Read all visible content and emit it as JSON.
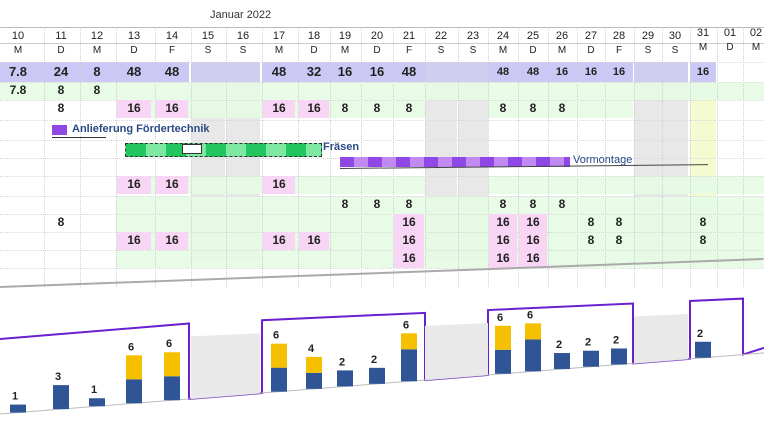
{
  "header": {
    "month": "Januar 2022"
  },
  "days": [
    {
      "d": "10",
      "w": "M"
    },
    {
      "d": "11",
      "w": "D"
    },
    {
      "d": "12",
      "w": "M"
    },
    {
      "d": "13",
      "w": "D"
    },
    {
      "d": "14",
      "w": "F"
    },
    {
      "d": "15",
      "w": "S"
    },
    {
      "d": "16",
      "w": "S"
    },
    {
      "d": "17",
      "w": "M"
    },
    {
      "d": "18",
      "w": "D"
    },
    {
      "d": "19",
      "w": "M"
    },
    {
      "d": "20",
      "w": "D"
    },
    {
      "d": "21",
      "w": "F"
    },
    {
      "d": "22",
      "w": "S"
    },
    {
      "d": "23",
      "w": "S"
    },
    {
      "d": "24",
      "w": "M"
    },
    {
      "d": "25",
      "w": "D"
    },
    {
      "d": "26",
      "w": "M"
    },
    {
      "d": "27",
      "w": "D"
    },
    {
      "d": "28",
      "w": "F"
    },
    {
      "d": "29",
      "w": "S"
    },
    {
      "d": "30",
      "w": "S"
    },
    {
      "d": "31",
      "w": "M"
    },
    {
      "d": "01",
      "w": "D"
    },
    {
      "d": "02",
      "w": "M"
    }
  ],
  "rows": [
    {
      "cells": {
        "0": "7.8",
        "1": "24",
        "2": "8",
        "3": "48",
        "4": "48",
        "7": "48",
        "8": "32",
        "9": "16",
        "10": "16",
        "11": "48",
        "14": "48",
        "15": "48",
        "16": "16",
        "17": "16",
        "18": "16",
        "21": "16"
      }
    },
    {
      "cells": {
        "0": "7.8",
        "1": "8",
        "2": "8"
      }
    },
    {
      "cells": {
        "1": "8",
        "3": "16",
        "4": "16",
        "7": "16",
        "8": "16",
        "9": "8",
        "10": "8",
        "11": "8",
        "14": "8",
        "15": "8",
        "16": "8"
      }
    },
    {
      "cells": {}
    },
    {
      "cells": {}
    },
    {
      "cells": {}
    },
    {
      "cells": {
        "3": "16",
        "4": "16",
        "7": "16"
      }
    },
    {
      "cells": {
        "9": "8",
        "10": "8",
        "11": "8",
        "14": "8",
        "15": "8",
        "16": "8"
      }
    },
    {
      "cells": {
        "1": "8",
        "11": "16",
        "14": "16",
        "15": "16",
        "17": "8",
        "18": "8",
        "21": "8"
      }
    },
    {
      "cells": {
        "3": "16",
        "4": "16",
        "7": "16",
        "8": "16",
        "11": "16",
        "14": "16",
        "15": "16",
        "17": "8",
        "18": "8",
        "21": "8"
      }
    },
    {
      "cells": {
        "11": "16",
        "14": "16",
        "15": "16"
      }
    }
  ],
  "tasks": {
    "anlieferung": "Anlieferung Fördertechnik",
    "fraesen": "Fräsen",
    "vormontage": "Vormontage"
  },
  "chart_data": {
    "type": "bar",
    "categories": [
      "10",
      "11",
      "12",
      "13",
      "14",
      "15",
      "16",
      "17",
      "18",
      "19",
      "20",
      "21",
      "22",
      "23",
      "24",
      "25",
      "26",
      "27",
      "28",
      "29",
      "30",
      "31"
    ],
    "series": [
      {
        "values": [
          1,
          3,
          1,
          3,
          3,
          0,
          0,
          3,
          2,
          2,
          2,
          4,
          0,
          0,
          3,
          4,
          2,
          2,
          2,
          0,
          0,
          2
        ],
        "color": "#2f5597"
      },
      {
        "values": [
          0,
          0,
          0,
          3,
          3,
          0,
          0,
          3,
          2,
          0,
          0,
          2,
          0,
          0,
          3,
          2,
          0,
          0,
          0,
          0,
          0,
          0
        ],
        "color": "#f5c000"
      }
    ],
    "labels": [
      "1",
      "3",
      "1",
      "6",
      "6",
      "",
      "",
      "6",
      "4",
      "2",
      "2",
      "6",
      "",
      "",
      "6",
      "6",
      "2",
      "2",
      "2",
      "",
      "",
      "2"
    ]
  },
  "colors": {
    "weekend": "#e8e8e8",
    "capacity": "#ccc8f5",
    "green": "#e4fbe4",
    "pink": "#f9d5f5",
    "task_purple": "#8f47e6",
    "task_green": "#22c55e",
    "highlight": "#f5fbd0",
    "capline": "#6a1fd0"
  }
}
